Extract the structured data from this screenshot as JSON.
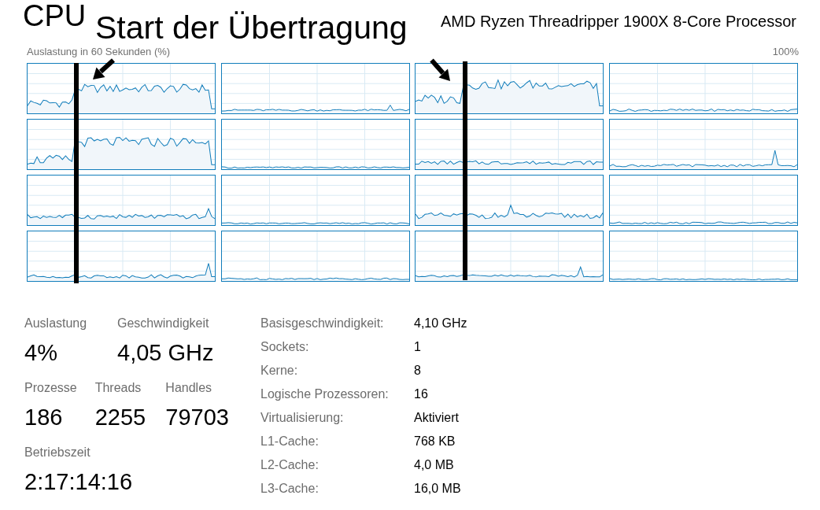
{
  "title": "CPU",
  "processor": "AMD Ryzen Threadripper 1900X 8-Core Processor",
  "annotation": "Start der Übertragung",
  "graph": {
    "caption": "Auslastung in 60 Sekunden (%)",
    "max_label": "100%"
  },
  "stat_rows": [
    {
      "items": [
        {
          "label": "Auslastung",
          "value": "4%"
        },
        {
          "label": "Geschwindigkeit",
          "value": "4,05 GHz"
        }
      ]
    },
    {
      "items": [
        {
          "label": "Prozesse",
          "value": "186"
        },
        {
          "label": "Threads",
          "value": "2255"
        },
        {
          "label": "Handles",
          "value": "79703"
        }
      ]
    },
    {
      "items": [
        {
          "label": "Betriebszeit",
          "value": "2:17:14:16"
        }
      ]
    }
  ],
  "details": [
    {
      "label": "Basisgeschwindigkeit:",
      "value": "4,10 GHz"
    },
    {
      "label": "Sockets:",
      "value": "1"
    },
    {
      "label": "Kerne:",
      "value": "8"
    },
    {
      "label": "Logische Prozessoren:",
      "value": "16"
    },
    {
      "label": "Virtualisierung:",
      "value": "Aktiviert"
    },
    {
      "label": "L1-Cache:",
      "value": "768 KB"
    },
    {
      "label": "L2-Cache:",
      "value": "4,0 MB"
    },
    {
      "label": "L3-Cache:",
      "value": "16,0 MB"
    }
  ]
}
